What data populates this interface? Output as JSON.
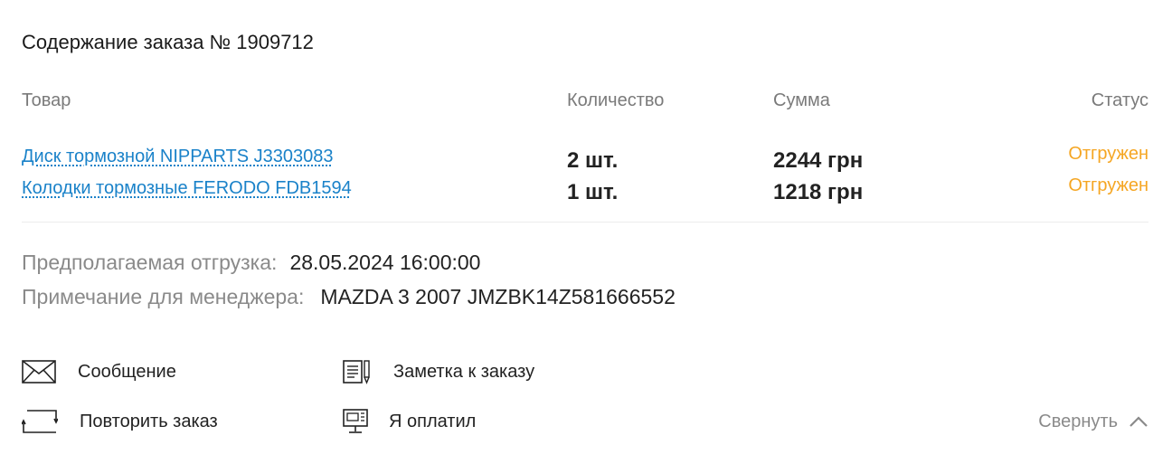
{
  "order": {
    "title": "Содержание заказа № 1909712"
  },
  "table": {
    "headers": {
      "product": "Товар",
      "quantity": "Количество",
      "sum": "Сумма",
      "status": "Статус"
    },
    "rows": [
      {
        "product": "Диск тормозной NIPPARTS J3303083",
        "quantity": "2 шт.",
        "sum": "2244 грн",
        "status": "Отгружен"
      },
      {
        "product": "Колодки тормозные FERODO FDB1594",
        "quantity": "1 шт.",
        "sum": "1218 грн",
        "status": "Отгружен"
      }
    ]
  },
  "info": {
    "shipment_label": "Предполагаемая отгрузка:",
    "shipment_value": "28.05.2024 16:00:00",
    "note_label": "Примечание для менеджера:",
    "note_value": "MAZDA 3 2007 JMZBK14Z581666552"
  },
  "actions": {
    "message": {
      "label": "Сообщение",
      "icon": "envelope-icon"
    },
    "order_note": {
      "label": "Заметка к заказу",
      "icon": "note-icon"
    },
    "repeat_order": {
      "label": "Повторить заказ",
      "icon": "repeat-icon"
    },
    "i_paid": {
      "label": "Я оплатил",
      "icon": "payment-terminal-icon"
    },
    "collapse": {
      "label": "Свернуть",
      "icon": "chevron-up-icon"
    }
  },
  "colors": {
    "link": "#1a82c9",
    "status": "#f5a623",
    "muted": "#8a8a8a"
  }
}
